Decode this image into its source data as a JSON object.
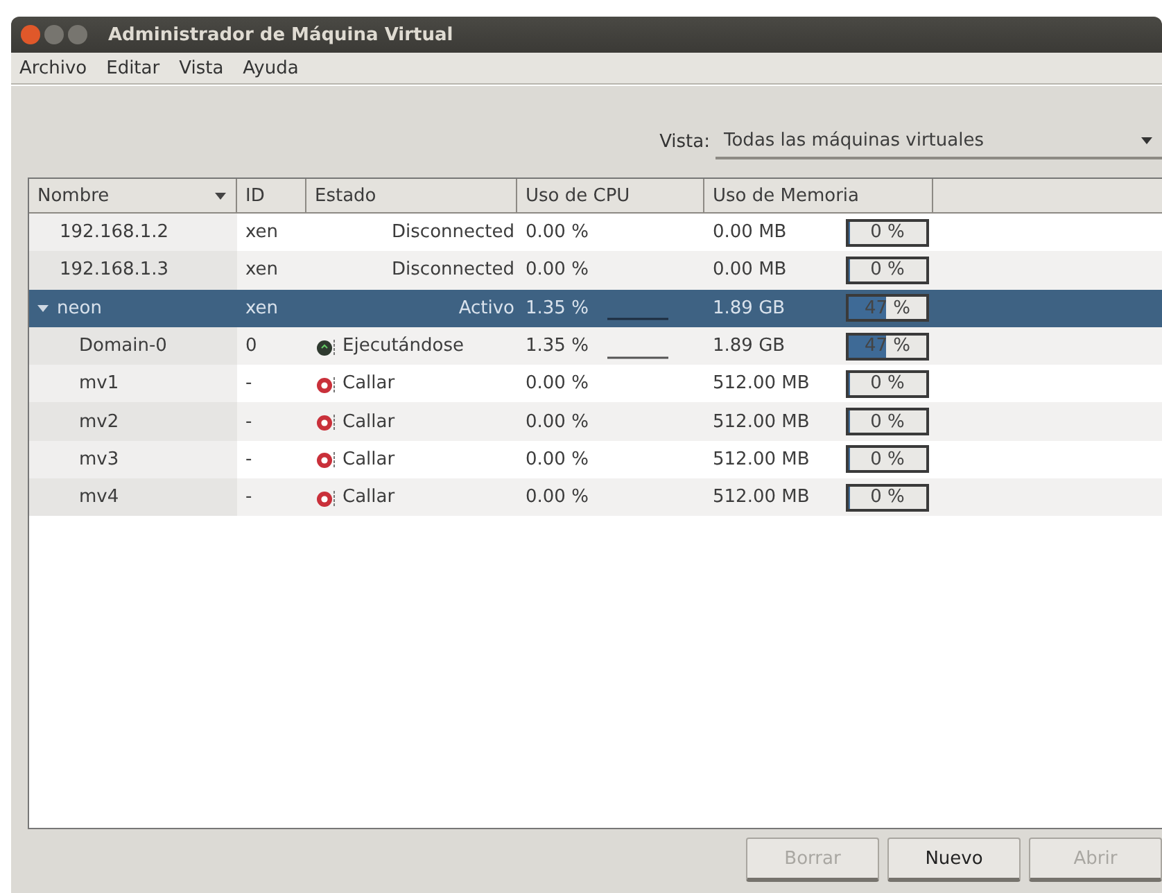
{
  "window": {
    "title": "Administrador de Máquina Virtual"
  },
  "menu": [
    {
      "label": "Archivo"
    },
    {
      "label": "Editar"
    },
    {
      "label": "Vista"
    },
    {
      "label": "Ayuda"
    }
  ],
  "view_filter": {
    "label": "Vista:",
    "value": "Todas las máquinas virtuales"
  },
  "table": {
    "columns": [
      {
        "label": "Nombre",
        "sorted": true
      },
      {
        "label": "ID",
        "sorted": false
      },
      {
        "label": "Estado",
        "sorted": false
      },
      {
        "label": "Uso de CPU",
        "sorted": false
      },
      {
        "label": "Uso de Memoria",
        "sorted": false
      }
    ],
    "rows": [
      {
        "name": "192.168.1.2",
        "id": "xen",
        "state": "Disconnected",
        "cpu": "0.00 %",
        "cpu_graph": false,
        "memory": "0.00 MB",
        "meter": {
          "level": 0,
          "text": "0 %"
        },
        "selected": false
      },
      {
        "name": "192.168.1.3",
        "id": "xen",
        "state": "Disconnected",
        "cpu": "0.00 %",
        "cpu_graph": false,
        "memory": "0.00 MB",
        "meter": {
          "level": 0,
          "text": "0 %"
        },
        "selected": false
      },
      {
        "name": "neon",
        "id": "xen",
        "state": "Activo",
        "cpu": "1.35 %",
        "cpu_graph": true,
        "memory": "1.89 GB",
        "meter": {
          "level": 0.47,
          "text": "47 %"
        },
        "selected": true,
        "expanded": true,
        "children": [
          {
            "kind": "running",
            "name": "Domain-0",
            "id": "0",
            "state": "Ejecutándose",
            "cpu": "1.35 %",
            "cpu_graph": true,
            "memory": "1.89 GB",
            "meter": {
              "level": 0.47,
              "text": "47 %"
            },
            "selected": false
          },
          {
            "kind": "shutoff",
            "name": "mv1",
            "id": "-",
            "state": "Callar",
            "cpu": "0.00 %",
            "cpu_graph": false,
            "memory": "512.00 MB",
            "meter": {
              "level": 0,
              "text": "0 %"
            },
            "selected": false
          },
          {
            "kind": "shutoff",
            "name": "mv2",
            "id": "-",
            "state": "Callar",
            "cpu": "0.00 %",
            "cpu_graph": false,
            "memory": "512.00 MB",
            "meter": {
              "level": 0,
              "text": "0 %"
            },
            "selected": false
          },
          {
            "kind": "shutoff",
            "name": "mv3",
            "id": "-",
            "state": "Callar",
            "cpu": "0.00 %",
            "cpu_graph": false,
            "memory": "512.00 MB",
            "meter": {
              "level": 0,
              "text": "0 %"
            },
            "selected": false
          },
          {
            "kind": "shutoff",
            "name": "mv4",
            "id": "-",
            "state": "Callar",
            "cpu": "0.00 %",
            "cpu_graph": false,
            "memory": "512.00 MB",
            "meter": {
              "level": 0,
              "text": "0 %"
            },
            "selected": false
          }
        ]
      }
    ]
  },
  "buttons": [
    {
      "label": "Borrar",
      "disabled": true
    },
    {
      "label": "Nuevo",
      "disabled": false
    },
    {
      "label": "Abrir",
      "disabled": true
    }
  ]
}
